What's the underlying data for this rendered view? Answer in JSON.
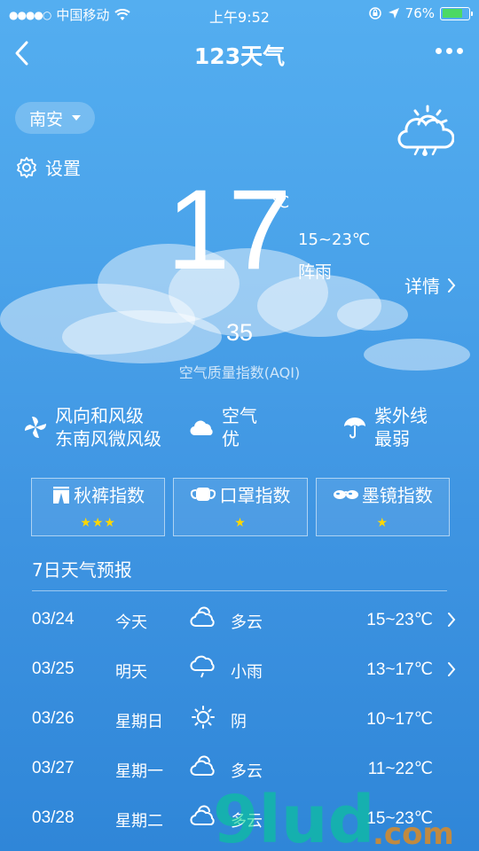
{
  "status_bar": {
    "carrier": "中国移动",
    "time": "上午9:52",
    "battery": "76%",
    "battery_level": 0.76
  },
  "nav": {
    "title": "123天气"
  },
  "location": {
    "city": "南安"
  },
  "settings": {
    "label": "设置"
  },
  "current": {
    "temp": "17",
    "unit": "℃",
    "range": "15~23℃",
    "condition": "阵雨",
    "detail_label": "详情",
    "aqi": "35",
    "aqi_label": "空气质量指数(AQI)"
  },
  "info": {
    "wind_title": "风向和风级",
    "wind_value": "东南风微风级",
    "air_title": "空气",
    "air_value": "优",
    "uv_title": "紫外线",
    "uv_value": "最弱"
  },
  "indices": [
    {
      "label": "秋裤指数",
      "stars": "★★★",
      "icon": "pants-icon"
    },
    {
      "label": "口罩指数",
      "stars": "★",
      "icon": "mask-icon"
    },
    {
      "label": "墨镜指数",
      "stars": "★",
      "icon": "sunglasses-icon"
    }
  ],
  "forecast": {
    "title": "7日天气预报",
    "days": [
      {
        "date": "03/24",
        "day": "今天",
        "icon": "cloudy-icon",
        "condition": "多云",
        "range": "15~23℃",
        "has_detail": true
      },
      {
        "date": "03/25",
        "day": "明天",
        "icon": "light-rain-icon",
        "condition": "小雨",
        "range": "13~17℃",
        "has_detail": true
      },
      {
        "date": "03/26",
        "day": "星期日",
        "icon": "overcast-icon",
        "condition": "阴",
        "range": "10~17℃",
        "has_detail": false
      },
      {
        "date": "03/27",
        "day": "星期一",
        "icon": "cloudy-icon",
        "condition": "多云",
        "range": "11~22℃",
        "has_detail": false
      },
      {
        "date": "03/28",
        "day": "星期二",
        "icon": "cloudy-icon",
        "condition": "多云",
        "range": "15~23℃",
        "has_detail": false
      }
    ]
  },
  "watermark": {
    "logo": "9lud",
    "domain": ".com"
  },
  "colors": {
    "star": "#ffd700",
    "battery_fill": "#4cd964"
  }
}
